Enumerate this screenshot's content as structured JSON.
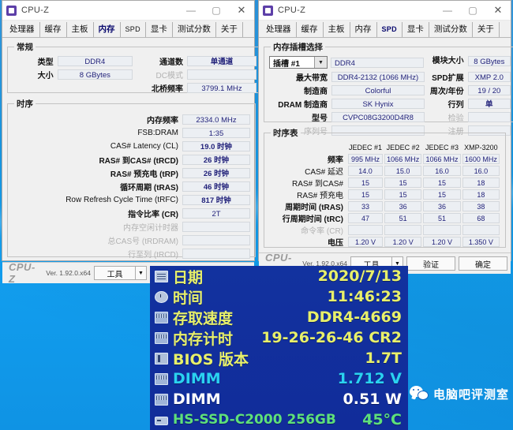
{
  "window_left": {
    "title": "CPU-Z",
    "controls": {
      "minimize": "—",
      "maximize": "▢",
      "close": "✕"
    },
    "tabs": [
      {
        "label": "处理器",
        "selected": false
      },
      {
        "label": "缓存",
        "selected": false
      },
      {
        "label": "主板",
        "selected": false
      },
      {
        "label": "内存",
        "selected": true
      },
      {
        "label": "SPD",
        "selected": false,
        "latin": true
      },
      {
        "label": "显卡",
        "selected": false
      },
      {
        "label": "测试分数",
        "selected": false
      },
      {
        "label": "关于",
        "selected": false
      }
    ],
    "general": {
      "legend": "常规",
      "type_label": "类型",
      "type_value": "DDR4",
      "size_label": "大小",
      "size_value": "8 GBytes",
      "channels_label": "通道数",
      "channels_value": "单通道",
      "dc_label": "DC模式",
      "dc_value": "",
      "nb_label": "北桥频率",
      "nb_value": "3799.1 MHz"
    },
    "timings": {
      "legend": "时序",
      "rows": [
        {
          "label": "内存频率",
          "value": "2334.0 MHz",
          "bold": true,
          "dim": false
        },
        {
          "label": "FSB:DRAM",
          "value": "1:35",
          "bold": false,
          "dim": false
        },
        {
          "label": "CAS# Latency (CL)",
          "value": "19.0 时钟",
          "bold": false,
          "dim": false
        },
        {
          "label": "RAS# 到CAS#  (tRCD)",
          "value": "26 时钟",
          "bold": true,
          "dim": false
        },
        {
          "label": "RAS# 预充电 (tRP)",
          "value": "26 时钟",
          "bold": true,
          "dim": false
        },
        {
          "label": "循环周期 (tRAS)",
          "value": "46 时钟",
          "bold": true,
          "dim": false
        },
        {
          "label": "Row Refresh Cycle Time (tRFC)",
          "value": "817 时钟",
          "bold": false,
          "dim": false
        },
        {
          "label": "指令比率 (CR)",
          "value": "2T",
          "bold": true,
          "dim": false
        },
        {
          "label": "内存空闲计时器",
          "value": "",
          "bold": false,
          "dim": true
        },
        {
          "label": "总CAS号 (tRDRAM)",
          "value": "",
          "bold": false,
          "dim": true
        },
        {
          "label": "行至列 (tRCD)",
          "value": "",
          "bold": false,
          "dim": true
        }
      ]
    },
    "footer": {
      "brand": "CPU-Z",
      "version": "Ver. 1.92.0.x64",
      "tools": "工具",
      "arrow": "▼",
      "validate": "验证",
      "ok": "确定"
    }
  },
  "window_right": {
    "title": "CPU-Z",
    "controls": {
      "minimize": "—",
      "maximize": "▢",
      "close": "✕"
    },
    "tabs": [
      {
        "label": "处理器",
        "selected": false
      },
      {
        "label": "缓存",
        "selected": false
      },
      {
        "label": "主板",
        "selected": false
      },
      {
        "label": "内存",
        "selected": false
      },
      {
        "label": "SPD",
        "selected": true,
        "latin": true
      },
      {
        "label": "显卡",
        "selected": false
      },
      {
        "label": "测试分数",
        "selected": false
      },
      {
        "label": "关于",
        "selected": false
      }
    ],
    "slot": {
      "legend": "内存插槽选择",
      "selected": "插槽 #1",
      "arrow": "▼",
      "module_type": "DDR4",
      "left_rows": [
        {
          "label": "最大带宽",
          "value": "DDR4-2132 (1066 MHz)",
          "dim": false
        },
        {
          "label": "制造商",
          "value": "Colorful",
          "dim": false
        },
        {
          "label": "DRAM 制造商",
          "value": "SK Hynix",
          "dim": false
        },
        {
          "label": "型号",
          "value": "CVPC08G3200D4R8",
          "dim": false
        },
        {
          "label": "序列号",
          "value": "",
          "dim": true
        }
      ],
      "right_rows": [
        {
          "label": "模块大小",
          "value": "8 GBytes",
          "dim": false,
          "bold": false
        },
        {
          "label": "SPD扩展",
          "value": "XMP 2.0",
          "dim": false,
          "bold": false
        },
        {
          "label": "周次/年份",
          "value": "19 / 20",
          "dim": false,
          "bold": false
        },
        {
          "label": "行列",
          "value": "单",
          "dim": false,
          "bold": true
        },
        {
          "label": "检验",
          "value": "",
          "dim": true,
          "bold": false
        },
        {
          "label": "注册",
          "value": "",
          "dim": true,
          "bold": false
        }
      ]
    },
    "timing_table": {
      "legend": "时序表",
      "columns": [
        "JEDEC #1",
        "JEDEC #2",
        "JEDEC #3",
        "XMP-3200"
      ],
      "rows": [
        {
          "label": "频率",
          "bold": true,
          "dim": false,
          "values": [
            "995 MHz",
            "1066 MHz",
            "1066 MHz",
            "1600 MHz"
          ]
        },
        {
          "label": "CAS# 延迟",
          "bold": false,
          "dim": false,
          "values": [
            "14.0",
            "15.0",
            "16.0",
            "16.0"
          ]
        },
        {
          "label": "RAS# 到CAS#",
          "bold": false,
          "dim": false,
          "values": [
            "15",
            "15",
            "15",
            "18"
          ]
        },
        {
          "label": "RAS# 预充电",
          "bold": false,
          "dim": false,
          "values": [
            "15",
            "15",
            "15",
            "18"
          ]
        },
        {
          "label": "周期时间 (tRAS)",
          "bold": true,
          "dim": false,
          "values": [
            "33",
            "36",
            "36",
            "38"
          ]
        },
        {
          "label": "行周期时间 (tRC)",
          "bold": true,
          "dim": false,
          "values": [
            "47",
            "51",
            "51",
            "68"
          ]
        },
        {
          "label": "命令率 (CR)",
          "bold": false,
          "dim": true,
          "values": [
            "",
            "",
            "",
            ""
          ]
        },
        {
          "label": "电压",
          "bold": true,
          "dim": false,
          "values": [
            "1.20 V",
            "1.20 V",
            "1.20 V",
            "1.350 V"
          ]
        }
      ]
    },
    "footer": {
      "brand": "CPU-Z",
      "version": "Ver. 1.92.0.x64",
      "tools": "工具",
      "arrow": "▼",
      "validate": "验证",
      "ok": "确定"
    }
  },
  "osd": {
    "rows": [
      {
        "icon": "calendar-icon",
        "name": "日期",
        "value": "2020/7/13",
        "color": "#e8f06a"
      },
      {
        "icon": "clock-icon",
        "name": "时间",
        "value": "11:46:23",
        "color": "#e8f06a"
      },
      {
        "icon": "ram-icon",
        "name": "存取速度",
        "value": "DDR4-4669",
        "color": "#e8f06a"
      },
      {
        "icon": "ram-icon",
        "name": "内存计时",
        "value": "19-26-26-46 CR2",
        "color": "#e8f06a"
      },
      {
        "icon": "bios-icon",
        "name": "BIOS 版本",
        "value": "1.7T",
        "color": "#e8f06a"
      },
      {
        "icon": "ram-icon",
        "name": "DIMM",
        "value": "1.712 V",
        "color": "#2ad2f0"
      },
      {
        "icon": "ram-icon",
        "name": "DIMM",
        "value": "0.51 W",
        "color": "#ffffff"
      },
      {
        "icon": "ssd-icon",
        "name": "HS-SSD-C2000 256GB",
        "value": "45°C",
        "color": "#5ee07a"
      }
    ]
  },
  "watermark": {
    "text": "电脑吧评测室"
  },
  "colors": {
    "desktop_blue": "#1a9ae8",
    "osd_panel": "#11309f",
    "field_text": "#22227a",
    "tab_selected": "#0a0a6e"
  }
}
